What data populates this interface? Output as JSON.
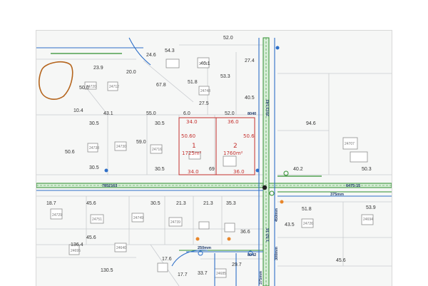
{
  "colors": {
    "background": "#ffffff",
    "map_bg": "#f6f7f6",
    "parcel_line": "#c9ccd0",
    "building": "#8e8e8e",
    "road_green": "#2f8f2f",
    "pipe_blue": "#2e6fc8",
    "subject_red": "#c4312f",
    "pond_brown": "#b5651d",
    "hydrant_orange": "#e8862a"
  },
  "dimension_labels": [
    {
      "text": "52.0"
    },
    {
      "text": "54.3"
    },
    {
      "text": "24.6"
    },
    {
      "text": "23.9"
    },
    {
      "text": "20.0"
    },
    {
      "text": "40.1"
    },
    {
      "text": "27.4"
    },
    {
      "text": "53.3"
    },
    {
      "text": "51.8"
    },
    {
      "text": "67.8"
    },
    {
      "text": "50.0"
    },
    {
      "text": "40.5"
    },
    {
      "text": "27.5"
    },
    {
      "text": "10.4"
    },
    {
      "text": "43.1"
    },
    {
      "text": "55.0"
    },
    {
      "text": "6.0"
    },
    {
      "text": "52.0"
    },
    {
      "text": "30.5"
    },
    {
      "text": "30.5"
    },
    {
      "text": "50.6"
    },
    {
      "text": "30.5"
    },
    {
      "text": "30.5"
    },
    {
      "text": "69"
    },
    {
      "text": "94.6"
    },
    {
      "text": "40.2"
    },
    {
      "text": "50.3"
    },
    {
      "text": "18.7"
    },
    {
      "text": "45.6"
    },
    {
      "text": "30.5"
    },
    {
      "text": "21.3"
    },
    {
      "text": "21.3"
    },
    {
      "text": "35.3"
    },
    {
      "text": "51.8"
    },
    {
      "text": "53.9"
    },
    {
      "text": "43.5"
    },
    {
      "text": "45.6"
    },
    {
      "text": "36.6"
    },
    {
      "text": "136.4"
    },
    {
      "text": "130.5"
    },
    {
      "text": "17.6"
    },
    {
      "text": "17.7"
    },
    {
      "text": "33.7"
    },
    {
      "text": "29.7"
    },
    {
      "text": "45.6"
    },
    {
      "text": "59.0"
    }
  ],
  "subject_lots": [
    {
      "number": "1",
      "area": "1725m²",
      "front": "34.0",
      "back": "34.0",
      "depth": "50.60"
    },
    {
      "number": "2",
      "area": "1760m²",
      "front": "36.0",
      "back": "36.0",
      "depth": "50.6"
    }
  ],
  "pipe_labels": [
    {
      "text": "7852163"
    },
    {
      "text": "6475:15"
    },
    {
      "text": "375mm"
    },
    {
      "text": "2013:143"
    },
    {
      "text": "250mm"
    },
    {
      "text": "1:52:16"
    },
    {
      "text": "450mm"
    },
    {
      "text": "300mm"
    },
    {
      "text": "375mm"
    },
    {
      "text": "8040"
    },
    {
      "text": "8042"
    }
  ],
  "address_numbers": [
    {
      "text": "24720"
    },
    {
      "text": "24712"
    },
    {
      "text": "24747"
    },
    {
      "text": "24748"
    },
    {
      "text": "24738"
    },
    {
      "text": "24730"
    },
    {
      "text": "24716"
    },
    {
      "text": "24707"
    },
    {
      "text": "24729"
    },
    {
      "text": "24751"
    },
    {
      "text": "24749"
    },
    {
      "text": "24739"
    },
    {
      "text": "24726"
    },
    {
      "text": "24694"
    },
    {
      "text": "24695"
    },
    {
      "text": "24640"
    },
    {
      "text": "24685"
    }
  ]
}
